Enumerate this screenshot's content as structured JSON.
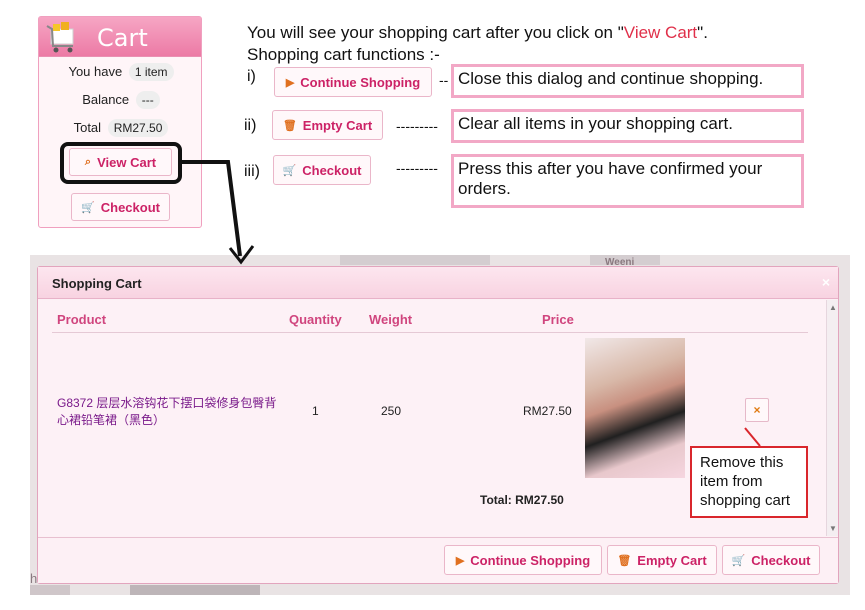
{
  "cart_widget": {
    "title": "Cart",
    "you_have_label": "You have",
    "item_count": "1 item",
    "balance_label": "Balance",
    "balance_value": "---",
    "total_label": "Total",
    "total_value": "RM27.50",
    "view_cart_label": "View Cart",
    "checkout_label": "Checkout"
  },
  "instructions": {
    "line1_prefix": "You will see your shopping cart after you click on \"",
    "line1_highlight": "View Cart",
    "line1_suffix": "\".",
    "line2": "Shopping cart functions :-",
    "items": [
      {
        "numeral": "i)",
        "button": "Continue Shopping",
        "dashes": "--",
        "description": "Close this dialog and continue shopping."
      },
      {
        "numeral": "ii)",
        "button": "Empty Cart",
        "dashes": "---------",
        "description": "Clear all items in your shopping cart."
      },
      {
        "numeral": "iii)",
        "button": "Checkout",
        "dashes": "---------",
        "description": "Press this after you have confirmed your orders."
      }
    ]
  },
  "background": {
    "left_text": "hwear",
    "partial_text": "Weeni"
  },
  "modal": {
    "title": "Shopping Cart",
    "close": "×",
    "columns": {
      "product": "Product",
      "quantity": "Quantity",
      "weight": "Weight",
      "price": "Price"
    },
    "row": {
      "product": "G8372 层层水溶钩花下摆口袋修身包臀背心裙铅笔裙（黑色）",
      "quantity": "1",
      "weight": "250",
      "price": "RM27.50",
      "remove": "×"
    },
    "total": "Total: RM27.50",
    "footer": {
      "continue_label": "Continue Shopping",
      "empty_label": "Empty Cart",
      "checkout_label": "Checkout"
    }
  },
  "remove_callout": "Remove this item from shopping cart",
  "colors": {
    "accent_pink": "#ec7aa5",
    "button_text": "#cc2266",
    "highlight_red": "#e0304a",
    "callout_border": "#f2a8c6"
  }
}
